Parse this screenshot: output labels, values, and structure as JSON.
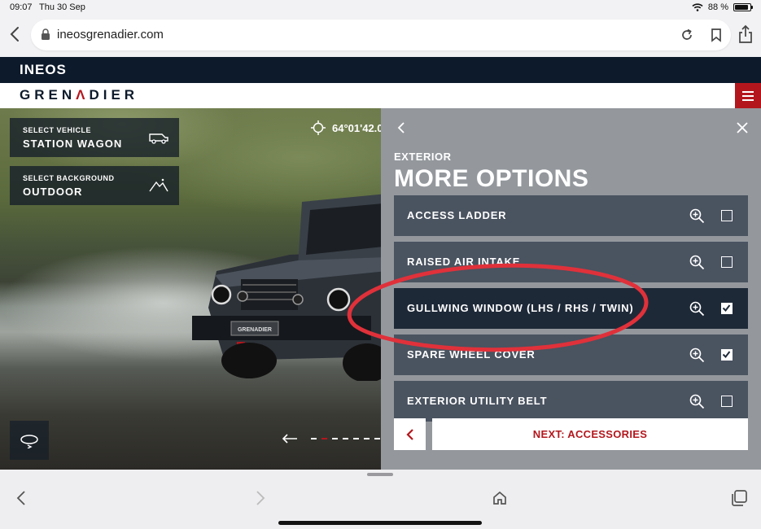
{
  "status": {
    "time": "09:07",
    "date": "Thu 30 Sep",
    "battery": "88 %",
    "battery_level": 0.88
  },
  "browser": {
    "url": "ineosgrenadier.com"
  },
  "site": {
    "ineos_logo": "INEOS",
    "brand_pre": "GREN",
    "brand_a": "Λ",
    "brand_post": "DIER"
  },
  "scene": {
    "vehicle_selector": {
      "label": "SELECT VEHICLE",
      "value": "STATION WAGON"
    },
    "background_selector": {
      "label": "SELECT BACKGROUND",
      "value": "OUTDOOR"
    },
    "coordinates": "64°01'42.0",
    "plate_text": "GRENADIER",
    "pager": {
      "count": 7,
      "active_index": 2
    }
  },
  "panel": {
    "category": "EXTERIOR",
    "title": "MORE OPTIONS",
    "options": [
      {
        "name": "ACCESS LADDER",
        "checked": false
      },
      {
        "name": "RAISED AIR INTAKE",
        "checked": false
      },
      {
        "name": "GULLWING WINDOW (LHS / RHS / TWIN)",
        "checked": true
      },
      {
        "name": "SPARE WHEEL COVER",
        "checked": true
      },
      {
        "name": "EXTERIOR UTILITY BELT",
        "checked": false
      }
    ],
    "next_label": "NEXT: ACCESSORIES"
  },
  "colors": {
    "brand_red": "#b3171d",
    "navy": "#0d1a2b",
    "option_bg": "#4a5360",
    "option_selected_bg": "#1e2938",
    "annotation": "#e0313a"
  }
}
